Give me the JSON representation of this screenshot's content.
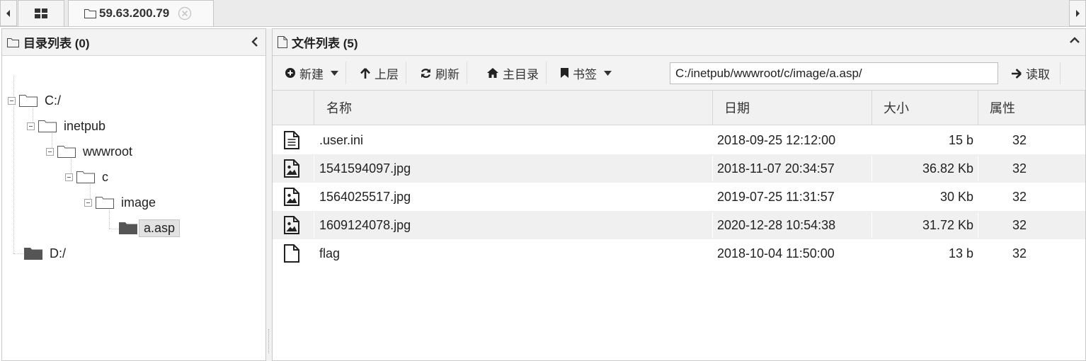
{
  "tabbar": {
    "host_tab": "59.63.200.79"
  },
  "left_panel": {
    "title": "目录列表 (0)",
    "tree": [
      {
        "label": "C:/"
      },
      {
        "label": "inetpub"
      },
      {
        "label": "wwwroot"
      },
      {
        "label": "c"
      },
      {
        "label": "image"
      },
      {
        "label": "a.asp",
        "selected": true
      },
      {
        "label": "D:/"
      }
    ]
  },
  "right_panel": {
    "title": "文件列表 (5)",
    "toolbar": {
      "new_label": "新建",
      "up_label": "上层",
      "refresh_label": "刷新",
      "home_label": "主目录",
      "bookmark_label": "书签",
      "path_value": "C:/inetpub/wwwroot/c/image/a.asp/",
      "read_label": "读取"
    },
    "columns": {
      "name": "名称",
      "date": "日期",
      "size": "大小",
      "attr": "属性"
    },
    "files": [
      {
        "icon": "text-file-icon",
        "name": ".user.ini",
        "date": "2018-09-25 12:12:00",
        "size": "15 b",
        "attr": "32"
      },
      {
        "icon": "image-file-icon",
        "name": "1541594097.jpg",
        "date": "2018-11-07 20:34:57",
        "size": "36.82 Kb",
        "attr": "32"
      },
      {
        "icon": "image-file-icon",
        "name": "1564025517.jpg",
        "date": "2019-07-25 11:31:57",
        "size": "30 Kb",
        "attr": "32"
      },
      {
        "icon": "image-file-icon",
        "name": "1609124078.jpg",
        "date": "2020-12-28 10:54:38",
        "size": "31.72 Kb",
        "attr": "32"
      },
      {
        "icon": "blank-file-icon",
        "name": "flag",
        "date": "2018-10-04 11:50:00",
        "size": "13 b",
        "attr": "32"
      }
    ]
  },
  "colors": {
    "panel_header_bg": "#f3f3f3",
    "row_alt_bg": "#f0f0f0",
    "folder_closed_fill": "#555555"
  }
}
